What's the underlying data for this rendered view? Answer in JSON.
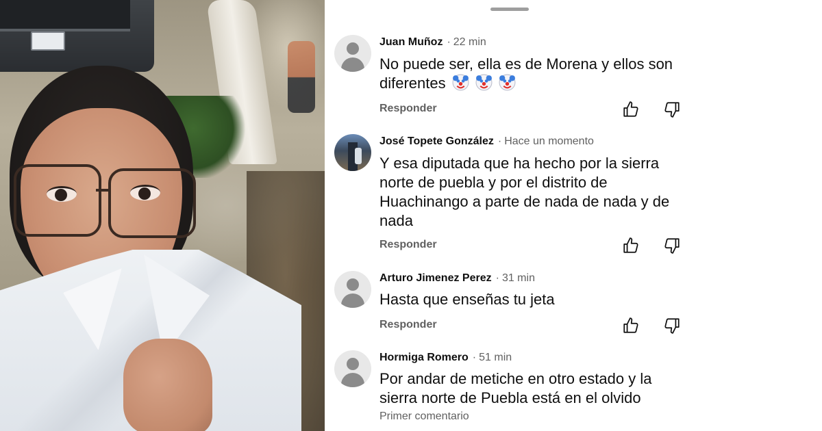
{
  "comments_panel": {
    "reply_label": "Responder",
    "comments": [
      {
        "author": "Juan Muñoz",
        "time": "22 min",
        "text": "No puede ser, ella es de Morena y ellos son diferentes",
        "emoji": "clown-face x3",
        "avatar": "default-avatar"
      },
      {
        "author": "José Topete González",
        "time": "Hace un momento",
        "text": "Y esa diputada que ha hecho por la sierra norte de puebla y por el distrito de Huachinango a parte de nada de nada y de nada",
        "avatar": "photo-avatar"
      },
      {
        "author": "Arturo Jimenez Perez",
        "time": "31 min",
        "text": "Hasta que enseñas tu jeta",
        "avatar": "default-avatar"
      },
      {
        "author": "Hormiga Romero",
        "time": "51 min",
        "text": "Por andar de metiche en otro estado y la sierra norte de Puebla está en el olvido",
        "footer": "Primer comentario",
        "avatar": "default-avatar"
      }
    ]
  },
  "icons": {
    "like": "thumb-up-icon",
    "dislike": "thumb-down-icon",
    "handle": "drag-handle"
  },
  "colors": {
    "text_primary": "#0f0f0f",
    "text_secondary": "#606060",
    "avatar_bg": "#e8e8e8",
    "avatar_fg": "#8b8b8b"
  }
}
